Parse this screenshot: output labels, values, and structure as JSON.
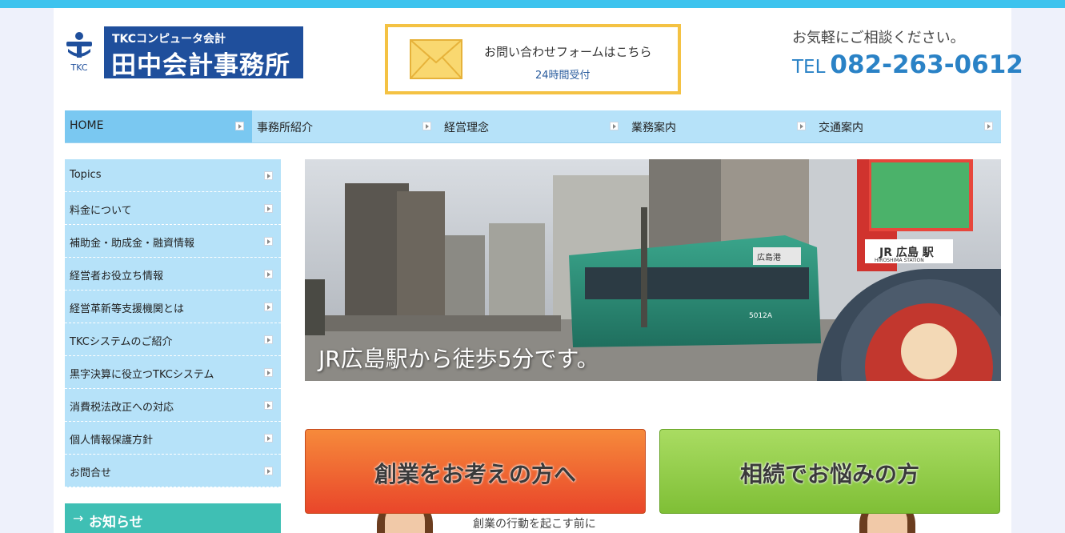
{
  "logo": {
    "mark_text": "TKC",
    "subtitle": "TKCコンピュータ会計",
    "name": "田中会計事務所",
    "color": "#1f4f9c"
  },
  "contact": {
    "title": "お問い合わせフォームはこちら",
    "subtitle": "24時間受付",
    "icon": "envelope-icon",
    "border_color": "#f4c243"
  },
  "tel": {
    "caption": "お気軽にご相談ください。",
    "prefix": "TEL",
    "number": "082-263-0612"
  },
  "global_nav": [
    {
      "label": "HOME",
      "active": true
    },
    {
      "label": "事務所紹介",
      "active": false
    },
    {
      "label": "経営理念",
      "active": false
    },
    {
      "label": "業務案内",
      "active": false
    },
    {
      "label": "交通案内",
      "active": false
    }
  ],
  "sidebar": {
    "items": [
      {
        "label": "Topics"
      },
      {
        "label": "料金について"
      },
      {
        "label": "補助金・助成金・融資情報"
      },
      {
        "label": "経営者お役立ち情報"
      },
      {
        "label": "経営革新等支援機関とは"
      },
      {
        "label": "TKCシステムのご紹介"
      },
      {
        "label": "黒字決算に役立つTKCシステム"
      },
      {
        "label": "消費税法改正への対応"
      },
      {
        "label": "個人情報保護方針"
      },
      {
        "label": "お問合せ"
      }
    ],
    "news_heading": "お知らせ",
    "news_arrow": "→"
  },
  "hero": {
    "caption": "JR広島駅から徒歩5分です。",
    "signs": {
      "station": "JR 広島 駅",
      "station_en": "HIROSHIMA STATION",
      "tram_number": "5012A",
      "tram_dest": "広島港"
    }
  },
  "banners": {
    "startup": {
      "label": "創業をお考えの方へ",
      "color_top": "#f68a3b",
      "color_bottom": "#e9462a"
    },
    "inheritance": {
      "label": "相続でお悩みの方",
      "color_top": "#a9dc62",
      "color_bottom": "#7fbf36"
    },
    "startup_sub": "創業の行動を起こす前に"
  },
  "colors": {
    "top_bar": "#3dc3ee",
    "nav_bg": "#b6e2f9",
    "nav_active": "#7ac8f1",
    "news_bg": "#3fbfb4",
    "tel_color": "#2a82c6"
  }
}
